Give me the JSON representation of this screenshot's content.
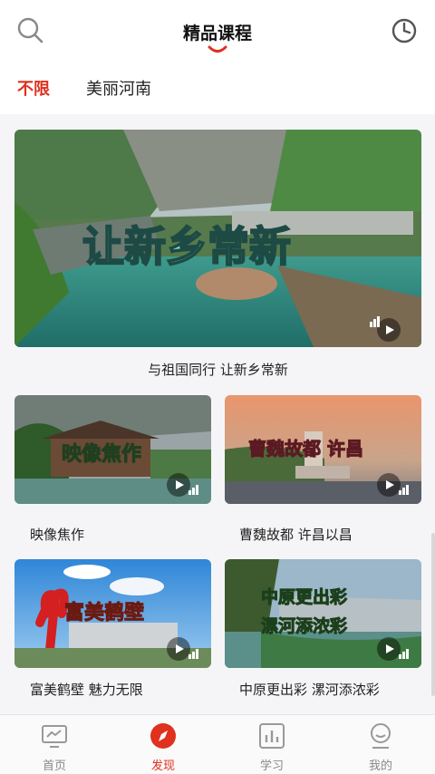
{
  "header": {
    "title": "精品课程",
    "search_icon": "search-icon",
    "history_icon": "clock-icon",
    "accent": "#e0301e"
  },
  "filters": [
    {
      "label": "不限",
      "selected": true
    },
    {
      "label": "美丽河南",
      "selected": false
    }
  ],
  "featured": {
    "caption": "与祖国同行 让新乡常新",
    "overlay": "让新乡常新"
  },
  "courses": [
    {
      "caption": "映像焦作",
      "overlay": "映像焦作"
    },
    {
      "caption": "曹魏故都 许昌以昌",
      "overlay": "曹魏故都 许昌"
    },
    {
      "caption": "富美鹤壁 魅力无限",
      "overlay": "富美鹤壁"
    },
    {
      "caption": "中原更出彩 漯河添浓彩",
      "overlay_line1": "中原更出彩",
      "overlay_line2": "漯河添浓彩"
    }
  ],
  "tabbar": [
    {
      "label": "首页",
      "icon": "monitor-icon",
      "active": false
    },
    {
      "label": "发现",
      "icon": "compass-icon",
      "active": true
    },
    {
      "label": "学习",
      "icon": "chart-icon",
      "active": false
    },
    {
      "label": "我的",
      "icon": "user-icon",
      "active": false
    }
  ]
}
